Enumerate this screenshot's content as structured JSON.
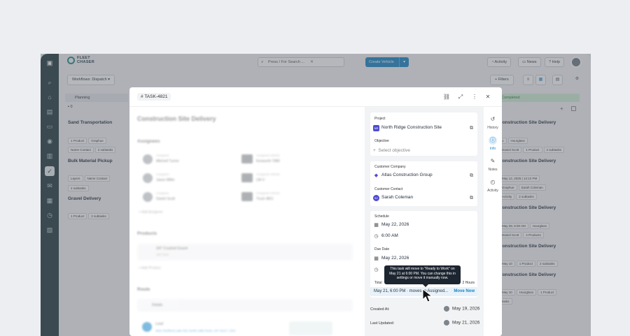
{
  "brand": {
    "line1": "FLEET",
    "line2": "CHASER"
  },
  "topbar": {
    "search_placeholder": "Press / For Search ...",
    "create_label": "Create Vehicle",
    "activity_label": "Activity",
    "news_label": "News",
    "help_label": "Help"
  },
  "board": {
    "workflow_label": "Workflows: Dispatch",
    "filters_label": "Filters",
    "planning": {
      "header": "Planning",
      "count": "0",
      "cards": [
        {
          "title": "Sand Transportation",
          "chips": [
            "1 Product",
            "Graphue"
          ],
          "chips2": [
            "Name Contact",
            "2 subtasks"
          ]
        },
        {
          "title": "Bulk Material Pickup",
          "chips": [
            "Layers",
            "Name Contact"
          ],
          "chips2": [
            "2 subtasks"
          ]
        },
        {
          "title": "Gravel Delivery",
          "chips": [
            "1 Product",
            "2 subtasks"
          ],
          "chips2": []
        }
      ]
    },
    "completed": {
      "header": "Completed",
      "cards": [
        {
          "title": "Construction Site Delivery",
          "chips": [
            "1",
            "Hourglass"
          ],
          "chips2": [
            "Daniel Scott",
            "1 Product",
            "2 subtasks"
          ]
        },
        {
          "title": "Construction Site Delivery",
          "chips": [
            "May 12, 2025 | 12:12 PM"
          ],
          "chips2": [
            "Graphue",
            "Sarah Coleman"
          ],
          "chips3": [
            "Activity",
            "2 subtasks"
          ]
        },
        {
          "title": "Construction Site Delivery",
          "chips": [
            "May 28, 6:00 AM",
            "Hourglass"
          ],
          "chips2": [
            "Daniel Scott",
            "4 Products"
          ]
        },
        {
          "title": "Construction Site Delivery",
          "chips": [
            "May 10",
            "1 Product",
            "2 subtasks"
          ]
        },
        {
          "title": "Construction Site Delivery",
          "chips": [
            "May 10",
            "Hourglass",
            "1 Product"
          ],
          "chips2": [
            "tasks"
          ]
        }
      ]
    }
  },
  "modal": {
    "task_id": "TASK-4821",
    "title": "Construction Site Delivery",
    "assignees_heading": "Assignees",
    "assignees": [
      {
        "role": "Assignee",
        "name": "Mitchell Turner",
        "vlabel": "Assigned vehicle",
        "vehicle": "Kenworth T880"
      },
      {
        "role": "Assignee",
        "name": "Jason Miller",
        "vlabel": "Assigned vehicle",
        "vehicle": "LW-V"
      },
      {
        "role": "Assignee",
        "name": "Daniel Scott",
        "vlabel": "Assigned vehicle",
        "vehicle": "Truck 4821"
      }
    ],
    "add_assignee": "Add Assignee",
    "products_heading": "Products",
    "product_name": "3/4\" Crushed Gravel",
    "product_qty": "100 Tons",
    "add_product": "Add Product",
    "route_heading": "Route",
    "route_details": "Details",
    "route_load": "Load",
    "route_address": "4821 Redford Lake Rd, North Little Rock, AR 72117, USA",
    "project_label": "Project",
    "project_value": "North Ridge Construction Site",
    "project_badge": "NR",
    "objective_label": "Objective",
    "objective_placeholder": "Select objective",
    "customer_company_label": "Customer Company",
    "customer_company_value": "Atlas Construction Group",
    "customer_contact_label": "Customer Contact",
    "customer_contact_value": "Sarah Coleman",
    "customer_contact_badge": "SC",
    "schedule_label": "Schedule",
    "schedule_date": "May 22, 2026",
    "schedule_time": "6:00 AM",
    "due_label": "Due Date",
    "due_date": "May 22, 2026",
    "total_label": "Total",
    "total_value": "2 Hours",
    "move_text": "May 21, 6:00 PM · moves to Assigned...",
    "move_now": "Move Now",
    "tooltip": "This task will move to \"Ready to Work\" on May 21 at 6:00 PM. You can change this in settings or move it manually now.",
    "created_label": "Created At:",
    "created_value": "May 19, 2026",
    "updated_label": "Last Updated:",
    "updated_value": "May 21, 2026"
  },
  "side_tabs": [
    {
      "label": "History",
      "icon": "history-icon"
    },
    {
      "label": "Info",
      "icon": "info-icon"
    },
    {
      "label": "Notes",
      "icon": "notes-icon"
    },
    {
      "label": "Activity",
      "icon": "activity-icon"
    }
  ],
  "colors": {
    "accent": "#1784c6",
    "sidebar": "#1f3a3d",
    "completed": "#cfeed5"
  }
}
